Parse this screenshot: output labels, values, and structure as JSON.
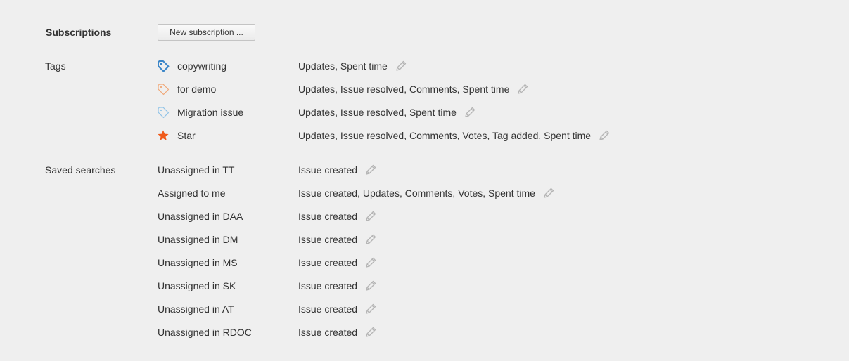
{
  "subscriptions": {
    "heading": "Subscriptions",
    "new_button_label": "New subscription ..."
  },
  "tags": {
    "label": "Tags",
    "items": [
      {
        "name": "copywriting",
        "events": "Updates, Spent time",
        "icon": "tag-icon",
        "color": "#3b86c8"
      },
      {
        "name": "for demo",
        "events": "Updates, Issue resolved, Comments, Spent time",
        "icon": "tag-icon",
        "color": "#f0a878"
      },
      {
        "name": "Migration issue",
        "events": "Updates, Issue resolved, Spent time",
        "icon": "tag-icon",
        "color": "#8fc3e8"
      },
      {
        "name": "Star",
        "events": "Updates, Issue resolved, Comments, Votes, Tag added, Spent time",
        "icon": "star-icon",
        "color": "#f05a1a"
      }
    ]
  },
  "saved_searches": {
    "label": "Saved searches",
    "items": [
      {
        "name": "Unassigned in TT",
        "events": "Issue created"
      },
      {
        "name": "Assigned to me",
        "events": "Issue created, Updates, Comments, Votes, Spent time"
      },
      {
        "name": "Unassigned in DAA",
        "events": "Issue created"
      },
      {
        "name": "Unassigned in DM",
        "events": "Issue created"
      },
      {
        "name": "Unassigned in MS",
        "events": "Issue created"
      },
      {
        "name": "Unassigned in SK",
        "events": "Issue created"
      },
      {
        "name": "Unassigned in AT",
        "events": "Issue created"
      },
      {
        "name": "Unassigned in RDOC",
        "events": "Issue created"
      }
    ]
  },
  "colors": {
    "background": "#efefef",
    "text": "#333333",
    "edit_icon": "#b5b5b5"
  }
}
